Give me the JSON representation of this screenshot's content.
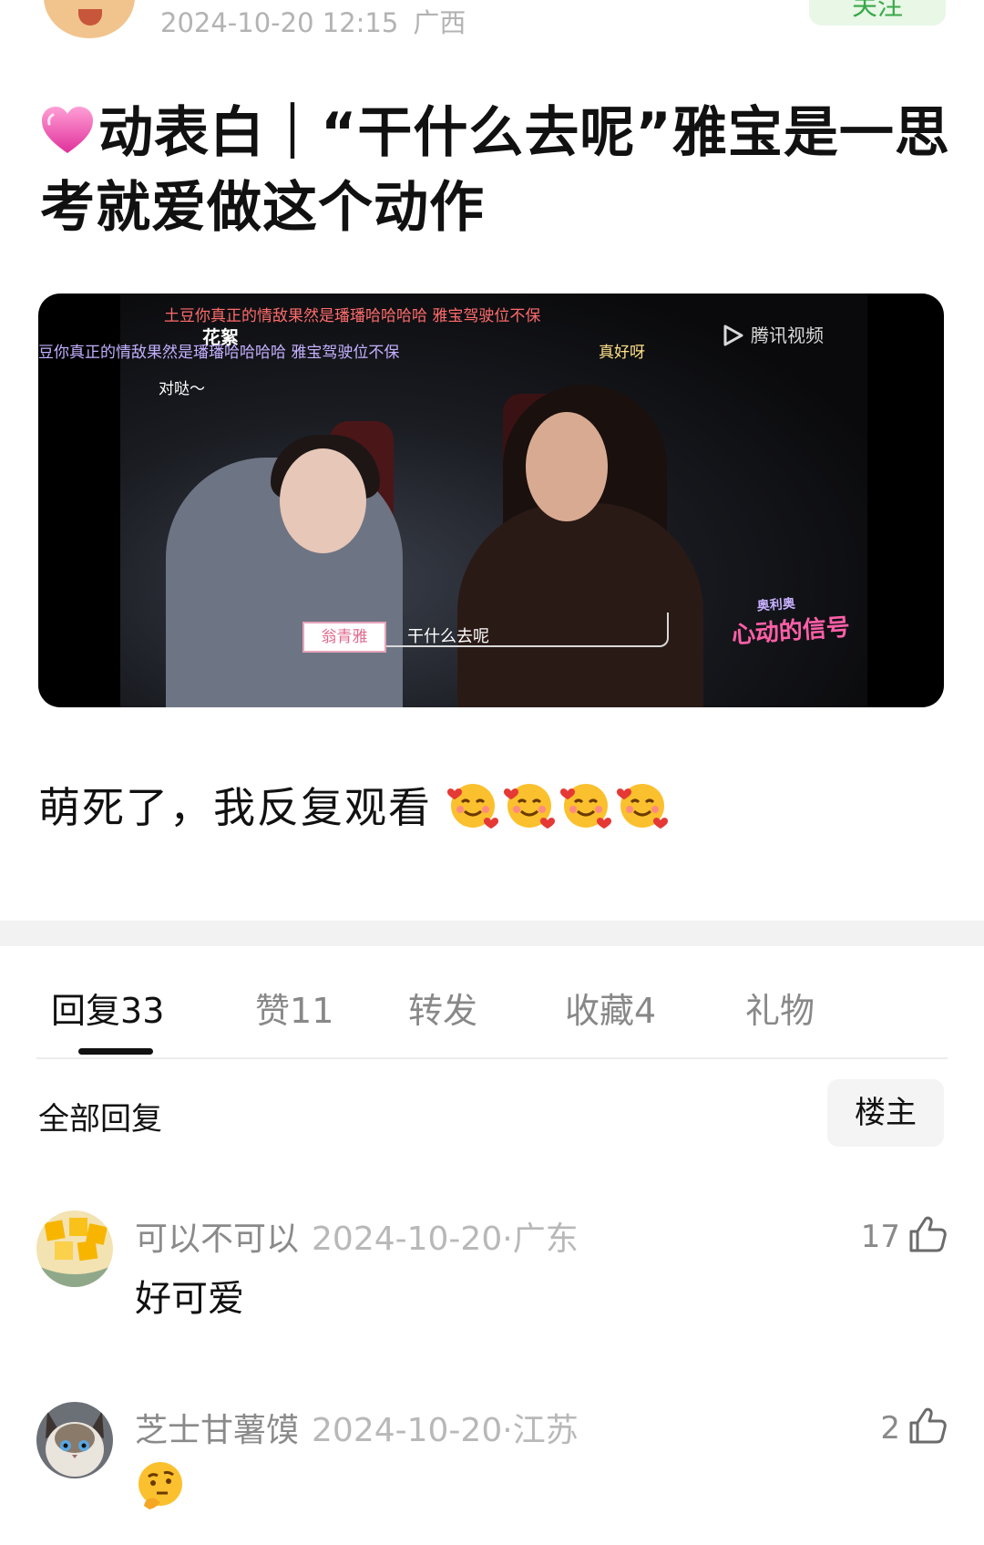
{
  "post": {
    "date": "2024-10-20 12:15",
    "location": "广西",
    "follow_label": "关注",
    "title": "动表白｜“干什么去呢”雅宝是一思考就爱做这个动作",
    "body": "萌死了，我反复观看"
  },
  "video": {
    "danmu": [
      "土豆你真正的情敌果然是璠璠哈哈哈哈 雅宝驾驶位不保",
      "豆你真正的情敌果然是璠璠哈哈哈哈 雅宝驾驶位不保",
      "真好呀",
      "对哒～"
    ],
    "tag_top": "花絮",
    "platform": "腾讯视频",
    "name_tag": "翁青雅",
    "subtitle": "干什么去呢",
    "show_logo": "心动的信号",
    "show_sponsor": "奥利奥"
  },
  "tabs": [
    {
      "label": "回复",
      "count": "33",
      "active": true
    },
    {
      "label": "赞",
      "count": "11",
      "active": false
    },
    {
      "label": "转发",
      "count": "",
      "active": false
    },
    {
      "label": "收藏",
      "count": "4",
      "active": false
    },
    {
      "label": "礼物",
      "count": "",
      "active": false
    }
  ],
  "replies": {
    "section_label": "全部回复",
    "filter_label": "楼主"
  },
  "comments": [
    {
      "user": "可以不可以",
      "date": "2024-10-20·",
      "location": "广东",
      "text": "好可爱",
      "likes": "17"
    },
    {
      "user": "芝士甘薯馍",
      "date": "2024-10-20·",
      "location": "江苏",
      "text": "",
      "likes": "2"
    }
  ],
  "colors": {
    "follow_bg": "#e8f7e6",
    "follow_text": "#3aa84a",
    "divider": "#f2f2f2",
    "muted": "#8a8a8a"
  },
  "icons": [
    "heart-icon",
    "smiling-hearts-emoji",
    "thumbs-up-icon",
    "thinking-emoji",
    "play-icon"
  ]
}
